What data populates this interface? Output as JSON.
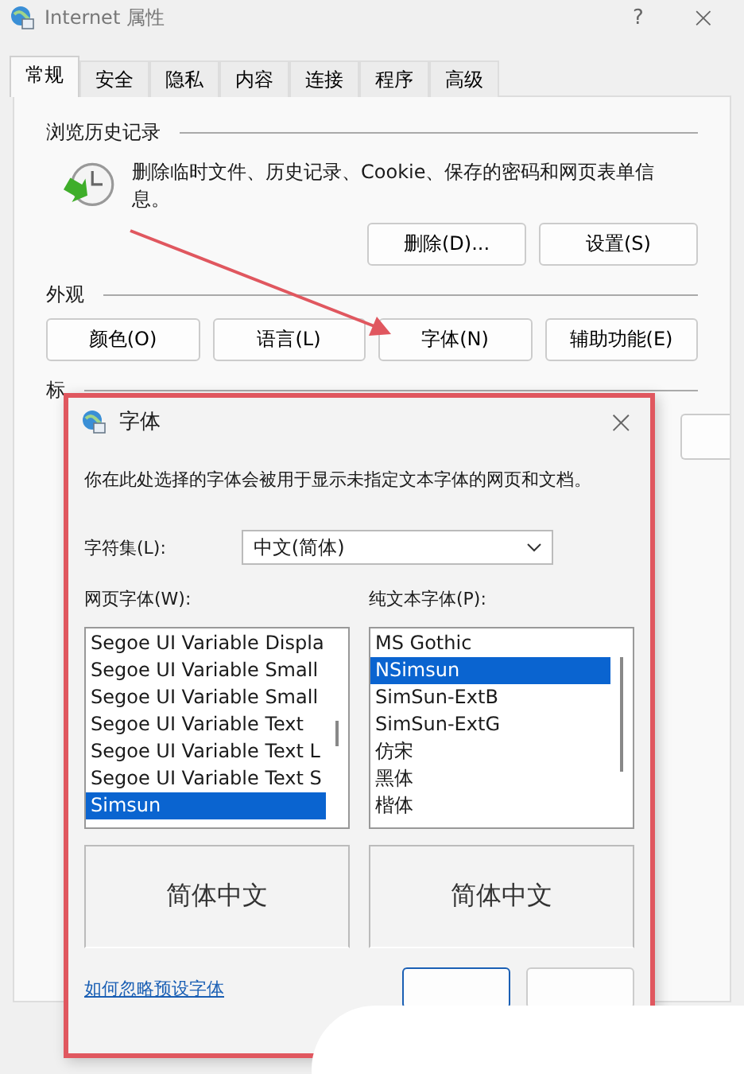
{
  "window": {
    "title": "Internet 属性",
    "help": "?",
    "close": "×"
  },
  "tabs": [
    {
      "label": "常规",
      "selected": true
    },
    {
      "label": "安全",
      "selected": false
    },
    {
      "label": "隐私",
      "selected": false
    },
    {
      "label": "内容",
      "selected": false
    },
    {
      "label": "连接",
      "selected": false
    },
    {
      "label": "程序",
      "selected": false
    },
    {
      "label": "高级",
      "selected": false
    }
  ],
  "history": {
    "heading": "浏览历史记录",
    "description": "删除临时文件、历史记录、Cookie、保存的密码和网页表单信息。",
    "buttons": [
      "删除(D)...",
      "设置(S)"
    ]
  },
  "appearance": {
    "heading": "外观",
    "buttons": [
      "颜色(O)",
      "语言(L)",
      "字体(N)",
      "辅助功能(E)"
    ]
  },
  "tabs_section": {
    "heading": "标"
  },
  "dialog": {
    "title": "字体",
    "close": "×",
    "description": "你在此处选择的字体会被用于显示未指定文本字体的网页和文档。",
    "charset": {
      "label": "字符集(L):",
      "value": "中文(简体)"
    },
    "web_fonts": {
      "label": "网页字体(W):",
      "items": [
        {
          "label": "Segoe UI Variable Displa",
          "selected": false
        },
        {
          "label": "Segoe UI Variable Small",
          "selected": false
        },
        {
          "label": "Segoe UI Variable Small",
          "selected": false
        },
        {
          "label": "Segoe UI Variable Text",
          "selected": false
        },
        {
          "label": "Segoe UI Variable Text L",
          "selected": false
        },
        {
          "label": "Segoe UI Variable Text S",
          "selected": false
        },
        {
          "label": "Simsun",
          "selected": true
        }
      ],
      "preview": "简体中文"
    },
    "plain_fonts": {
      "label": "纯文本字体(P):",
      "items": [
        {
          "label": "MS Gothic",
          "selected": false
        },
        {
          "label": "NSimsun",
          "selected": true
        },
        {
          "label": "SimSun-ExtB",
          "selected": false
        },
        {
          "label": "SimSun-ExtG",
          "selected": false
        },
        {
          "label": "仿宋",
          "selected": false
        },
        {
          "label": "黑体",
          "selected": false
        },
        {
          "label": "楷体",
          "selected": false
        }
      ],
      "preview": "简体中文"
    },
    "link": "如何忽略预设字体",
    "buttons": [
      {
        "kind": "primary"
      },
      {
        "kind": "secondary"
      }
    ]
  }
}
